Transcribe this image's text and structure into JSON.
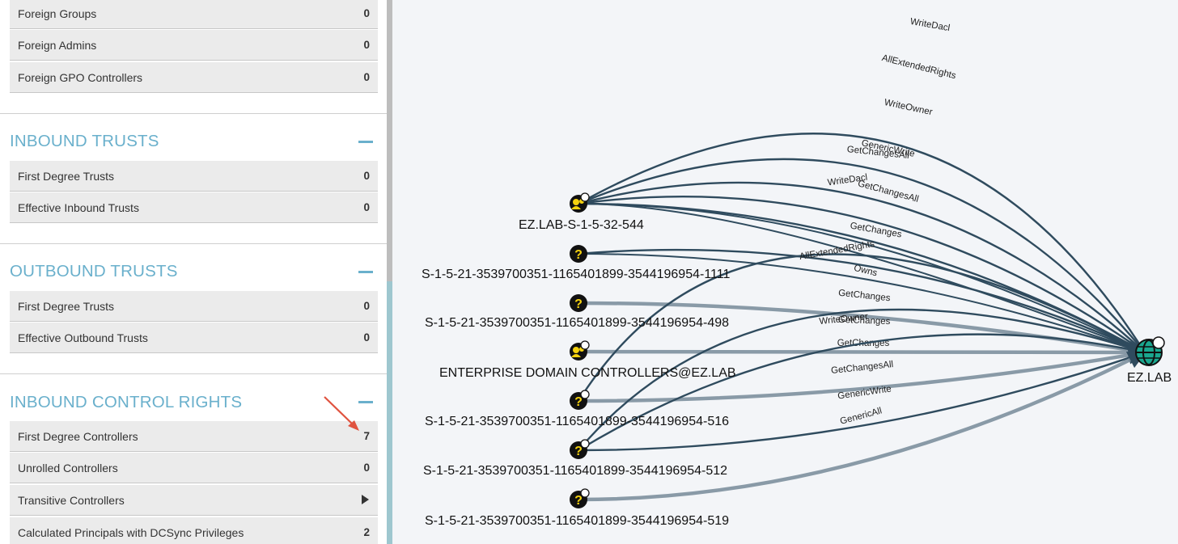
{
  "sidebar": {
    "top_rows": [
      {
        "label": "Foreign Groups",
        "value": "0"
      },
      {
        "label": "Foreign Admins",
        "value": "0"
      },
      {
        "label": "Foreign GPO Controllers",
        "value": "0"
      }
    ],
    "inbound_trusts": {
      "title": "INBOUND TRUSTS",
      "rows": [
        {
          "label": "First Degree Trusts",
          "value": "0"
        },
        {
          "label": "Effective Inbound Trusts",
          "value": "0"
        }
      ]
    },
    "outbound_trusts": {
      "title": "OUTBOUND TRUSTS",
      "rows": [
        {
          "label": "First Degree Trusts",
          "value": "0"
        },
        {
          "label": "Effective Outbound Trusts",
          "value": "0"
        }
      ]
    },
    "inbound_control_rights": {
      "title": "INBOUND CONTROL RIGHTS",
      "rows": [
        {
          "label": "First Degree Controllers",
          "value": "7"
        },
        {
          "label": "Unrolled Controllers",
          "value": "0"
        },
        {
          "label": "Transitive Controllers",
          "value": "",
          "icon": "play-arrow-icon"
        },
        {
          "label": "Calculated Principals with DCSync Privileges",
          "value": "2"
        }
      ]
    }
  },
  "graph": {
    "colors": {
      "edge": "#2f4b5e",
      "edge_light": "#7d909d",
      "node": "#111111",
      "badge": "#f5d20f",
      "domain": "#1aa78f"
    },
    "nodes": [
      {
        "id": "n544",
        "label": "EZ.LAB-S-1-5-32-544",
        "kind": "group-icon"
      },
      {
        "id": "n1111",
        "label": "S-1-5-21-3539700351-1165401899-3544196954-1111",
        "kind": "unknown-icon"
      },
      {
        "id": "n498",
        "label": "S-1-5-21-3539700351-1165401899-3544196954-498",
        "kind": "unknown-icon"
      },
      {
        "id": "nedc",
        "label": "ENTERPRISE DOMAIN CONTROLLERS@EZ.LAB",
        "kind": "group-icon"
      },
      {
        "id": "n516",
        "label": "S-1-5-21-3539700351-1165401899-3544196954-516",
        "kind": "unknown-icon"
      },
      {
        "id": "n512",
        "label": "S-1-5-21-3539700351-1165401899-3544196954-512",
        "kind": "unknown-icon"
      },
      {
        "id": "n519",
        "label": "S-1-5-21-3539700351-1165401899-3544196954-519",
        "kind": "unknown-icon"
      },
      {
        "id": "ezlab",
        "label": "EZ.LAB",
        "kind": "domain-icon"
      }
    ],
    "edges": [
      {
        "from": "n544",
        "label": "WriteDacl"
      },
      {
        "from": "n544",
        "label": "AllExtendedRights"
      },
      {
        "from": "n544",
        "label": "WriteOwner"
      },
      {
        "from": "n544",
        "label": "GenericWrite"
      },
      {
        "from": "n544",
        "label": "GetChangesAll"
      },
      {
        "from": "n544",
        "label": "GetChanges"
      },
      {
        "from": "n544",
        "label": "Owns"
      },
      {
        "from": "n1111",
        "label": "GetChangesAll"
      },
      {
        "from": "n1111",
        "label": "GetChanges"
      },
      {
        "from": "n498",
        "label": "GetChanges"
      },
      {
        "from": "nedc",
        "label": "GetChanges"
      },
      {
        "from": "n516",
        "label": "WriteDacl"
      },
      {
        "from": "n516",
        "label": "GetChangesAll"
      },
      {
        "from": "n512",
        "label": "AllExtendedRights"
      },
      {
        "from": "n512",
        "label": "WriteOwner"
      },
      {
        "from": "n512",
        "label": "GenericWrite"
      },
      {
        "from": "n519",
        "label": "GenericAll"
      }
    ]
  }
}
